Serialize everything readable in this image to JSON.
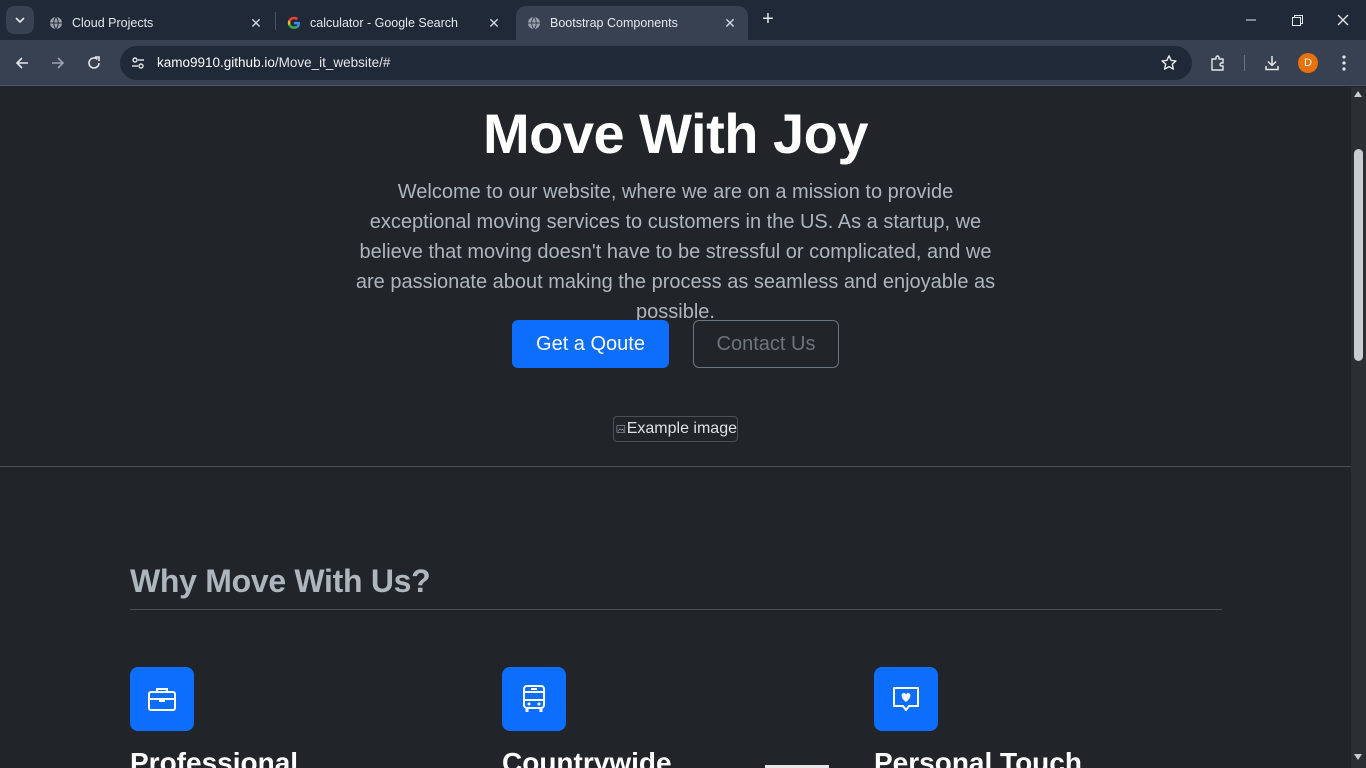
{
  "browser": {
    "tabs": [
      {
        "title": "Cloud Projects",
        "icon": "globe-icon"
      },
      {
        "title": "calculator - Google Search",
        "icon": "google-icon"
      },
      {
        "title": "Bootstrap Components",
        "icon": "globe-icon",
        "active": true
      }
    ],
    "url_host": "kamo9910.github.io",
    "url_path": "/Move_it_website/#",
    "profile_initial": "D",
    "accent": "#e8710a"
  },
  "hero": {
    "title": "Move With Joy",
    "lead": "Welcome to our website, where we are on a mission to provide exceptional moving services to customers in the US. As a startup, we believe that moving doesn't have to be stressful or complicated, and we are passionate about making the process as seamless and enjoyable as possible.",
    "primary_button": "Get a Qoute",
    "secondary_button": "Contact Us",
    "image_alt": "Example image"
  },
  "features": {
    "heading": "Why Move With Us?",
    "items": [
      {
        "title": "Professional",
        "icon": "briefcase-icon"
      },
      {
        "title": "Countrywide",
        "icon": "bus-icon"
      },
      {
        "title": "Personal Touch",
        "icon": "heart-chat-icon"
      }
    ]
  },
  "colors": {
    "primary": "#0d6efd",
    "background": "#212529",
    "muted_text": "#adb5bd"
  }
}
